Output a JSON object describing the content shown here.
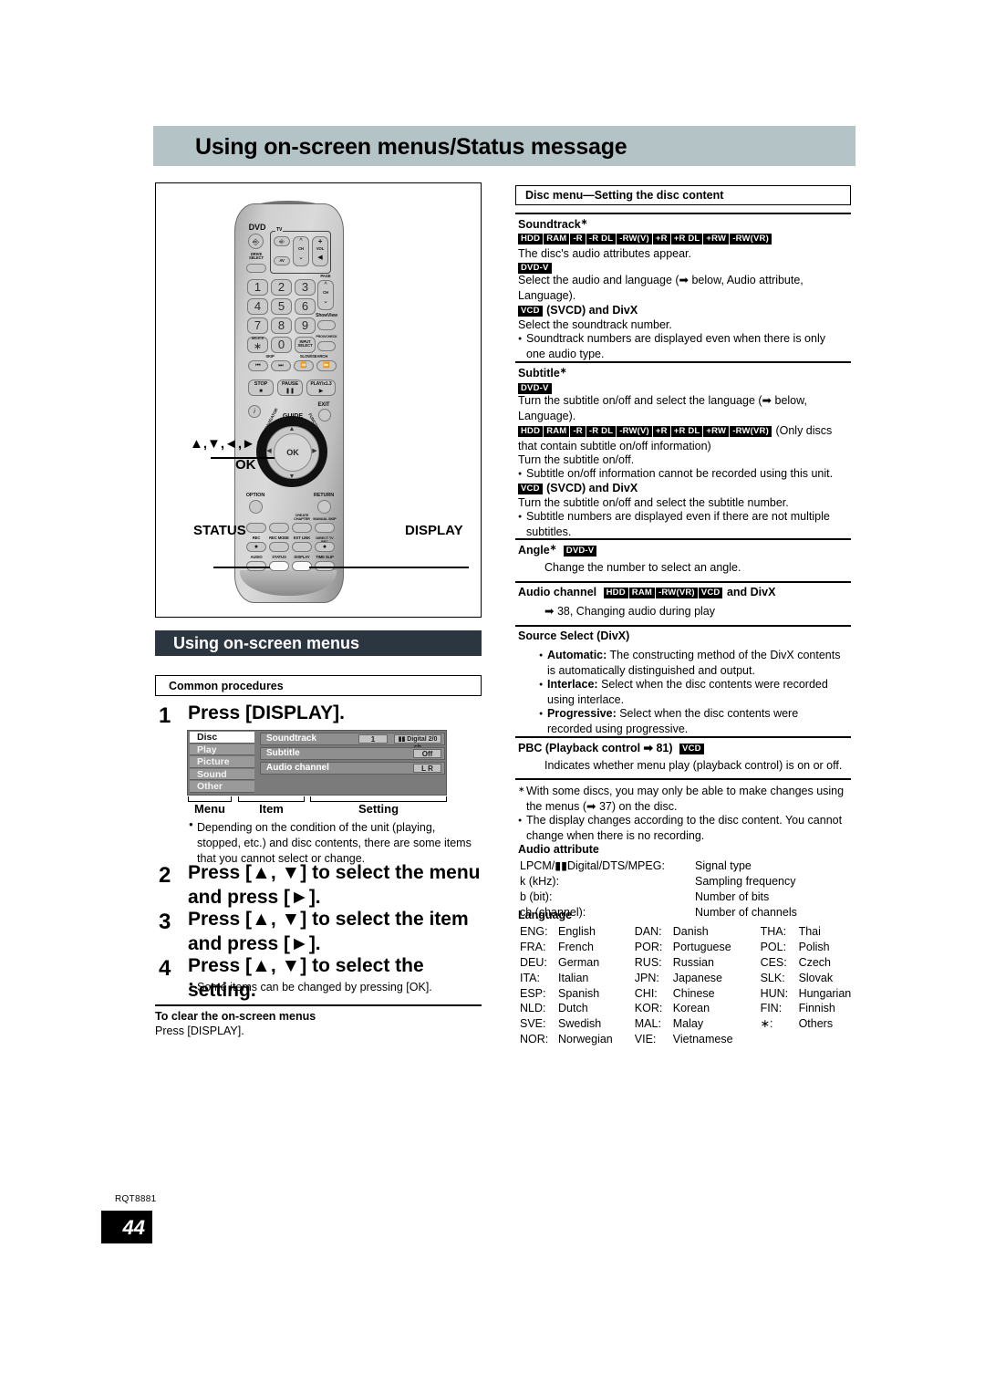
{
  "banner": {
    "title": "Using on-screen menus/Status message"
  },
  "remote": {
    "brand_label": "DVD",
    "drive_select": "DRIVE SELECT",
    "tv_group": "TV",
    "tv_av": "AV",
    "tv_ch": "CH",
    "tv_vol": "VOL",
    "tv_vol_plus": "+",
    "page": "PAGE",
    "page_ch": "CH",
    "numbers": [
      "1",
      "2",
      "3",
      "4",
      "5",
      "6",
      "7",
      "8",
      "9",
      "0"
    ],
    "showview": "ShowView",
    "prog_check": "PROG/CHECK",
    "delete": "DELETE",
    "asterisk": "∗",
    "input_select": "INPUT SELECT",
    "skip": "SKIP",
    "slow_search": "SLOW/SEARCH",
    "stop": "STOP",
    "pause": "PAUSE",
    "play": "PLAY/x1.3",
    "exit": "EXIT",
    "guide": "GUIDE",
    "direct_navigator": "DIRECT NAVIGATOR",
    "function_menu": "FUNCTION MENU",
    "ok": "OK",
    "option": "OPTION",
    "return": "RETURN",
    "create_chapter": "CREATE CHAPTER",
    "manual_skip": "MANUAL SKIP",
    "rec": "REC",
    "rec_mode": "REC MODE",
    "ext_link": "EXT LINK",
    "direct_tv_rec": "DIRECT TV REC",
    "audio": "AUDIO",
    "status": "STATUS",
    "display": "DISPLAY",
    "time_slip": "TIME SLIP"
  },
  "callouts": {
    "arrows": "▲,▼,◄,►",
    "ok": "OK",
    "status": "STATUS",
    "display": "DISPLAY"
  },
  "left": {
    "section_title": "Using on-screen menus",
    "subhead": "Common procedures",
    "steps": [
      {
        "num": "1",
        "text": "Press [DISPLAY]."
      },
      {
        "num": "2",
        "text": "Press [▲, ▼] to select the menu and press [►]."
      },
      {
        "num": "3",
        "text": "Press [▲, ▼] to select the item and press [►]."
      },
      {
        "num": "4",
        "text": "Press [▲, ▼] to select the setting."
      }
    ],
    "note_step1": "Depending on the condition of the unit (playing, stopped, etc.) and disc contents, there are some items that you cannot select or change.",
    "note_step4": "Some items can be changed by pressing [OK].",
    "clear_heading": "To clear the on-screen menus",
    "clear_text": "Press [DISPLAY]."
  },
  "osd": {
    "menu_items": [
      "Disc",
      "Play",
      "Picture",
      "Sound",
      "Other"
    ],
    "selected_menu": "Disc",
    "rows": [
      {
        "item": "Soundtrack",
        "value1": "1",
        "value2": "▮▮ Digital  2/0 ch"
      },
      {
        "item": "Subtitle",
        "value1": "",
        "value2": "Off"
      },
      {
        "item": "Audio channel",
        "value1": "",
        "value2": "L R"
      }
    ],
    "brace_labels": [
      "Menu",
      "Item",
      "Setting"
    ]
  },
  "right": {
    "box_title": "Disc menu—Setting the disc content",
    "soundtrack": {
      "heading": "Soundtrack",
      "asterisk": "∗",
      "tags1": [
        "HDD",
        "RAM",
        "-R",
        "-R DL",
        "-RW(V)",
        "+R",
        "+R DL",
        "+RW",
        "-RW(VR)"
      ],
      "line1": "The disc's audio attributes appear.",
      "tag_dvdv": "DVD-V",
      "line2": "Select the audio and language (➡ below, Audio attribute, Language).",
      "tag_vcd": "VCD",
      "line3_suffix": " (SVCD) and DivX",
      "line4": "Select the soundtrack number.",
      "bullet": "Soundtrack numbers are displayed even when there is only one audio type."
    },
    "subtitle": {
      "heading": "Subtitle",
      "asterisk": "∗",
      "tag_dvdv": "DVD-V",
      "line1": "Turn the subtitle on/off and select the language (➡ below, Language).",
      "tags2": [
        "HDD",
        "RAM",
        "-R",
        "-R DL",
        "-RW(V)",
        "+R",
        "+R DL",
        "+RW",
        "-RW(VR)"
      ],
      "line2_suffix": " (Only discs that contain subtitle on/off information)",
      "line3": "Turn the subtitle on/off.",
      "bullet1": "Subtitle on/off information cannot be recorded using this unit.",
      "tag_vcd": "VCD",
      "line4_suffix": " (SVCD) and DivX",
      "line5": "Turn the subtitle on/off and select the subtitle number.",
      "bullet2": "Subtitle numbers are displayed even if there are not multiple subtitles."
    },
    "angle": {
      "heading": "Angle",
      "asterisk": "∗",
      "tag": "DVD-V",
      "text": "Change the number to select an angle."
    },
    "audio_channel": {
      "heading": "Audio channel",
      "tags": [
        "HDD",
        "RAM",
        "-RW(VR)",
        "VCD"
      ],
      "heading_suffix": " and DivX",
      "ref": "➡ 38, Changing audio during play"
    },
    "source_select": {
      "heading": "Source Select (DivX)",
      "items": [
        {
          "label": "Automatic:",
          "text": "The constructing method of the DivX contents is automatically distinguished and output."
        },
        {
          "label": "Interlace:",
          "text": "Select when the disc contents were recorded using interlace."
        },
        {
          "label": "Progressive:",
          "text": "Select when the disc contents were recorded using progressive."
        }
      ]
    },
    "pbc": {
      "heading": "PBC (Playback control ➡ 81)",
      "tag": "VCD",
      "text": "Indicates whether menu play (playback control) is on or off."
    },
    "footnote_asterisk": "∗",
    "footnote": "With some discs, you may only be able to make changes using the menus (➡ 37) on the disc.",
    "bullet_display": "The display changes according to the disc content. You cannot change when there is no recording.",
    "audio_attribute": {
      "heading": "Audio attribute",
      "rows": [
        {
          "left": "LPCM/▮▮Digital/DTS/MPEG:",
          "right": "Signal type"
        },
        {
          "left": "k (kHz):",
          "right": "Sampling frequency"
        },
        {
          "left": "b (bit):",
          "right": "Number of bits"
        },
        {
          "left": "ch (channel):",
          "right": "Number of channels"
        }
      ]
    },
    "language": {
      "heading": "Language",
      "col1": [
        {
          "code": "ENG:",
          "name": "English"
        },
        {
          "code": "FRA:",
          "name": "French"
        },
        {
          "code": "DEU:",
          "name": "German"
        },
        {
          "code": "ITA:",
          "name": "Italian"
        },
        {
          "code": "ESP:",
          "name": "Spanish"
        },
        {
          "code": "NLD:",
          "name": "Dutch"
        },
        {
          "code": "SVE:",
          "name": "Swedish"
        },
        {
          "code": "NOR:",
          "name": "Norwegian"
        }
      ],
      "col2": [
        {
          "code": "DAN:",
          "name": "Danish"
        },
        {
          "code": "POR:",
          "name": "Portuguese"
        },
        {
          "code": "RUS:",
          "name": "Russian"
        },
        {
          "code": "JPN:",
          "name": "Japanese"
        },
        {
          "code": "CHI:",
          "name": "Chinese"
        },
        {
          "code": "KOR:",
          "name": "Korean"
        },
        {
          "code": "MAL:",
          "name": "Malay"
        },
        {
          "code": "VIE:",
          "name": "Vietnamese"
        }
      ],
      "col3": [
        {
          "code": "THA:",
          "name": "Thai"
        },
        {
          "code": "POL:",
          "name": "Polish"
        },
        {
          "code": "CES:",
          "name": "Czech"
        },
        {
          "code": "SLK:",
          "name": "Slovak"
        },
        {
          "code": "HUN:",
          "name": "Hungarian"
        },
        {
          "code": "FIN:",
          "name": "Finnish"
        },
        {
          "code": "∗:",
          "name": "Others"
        }
      ]
    }
  },
  "footer": {
    "doc_code": "RQT8881",
    "page_number": "44"
  }
}
